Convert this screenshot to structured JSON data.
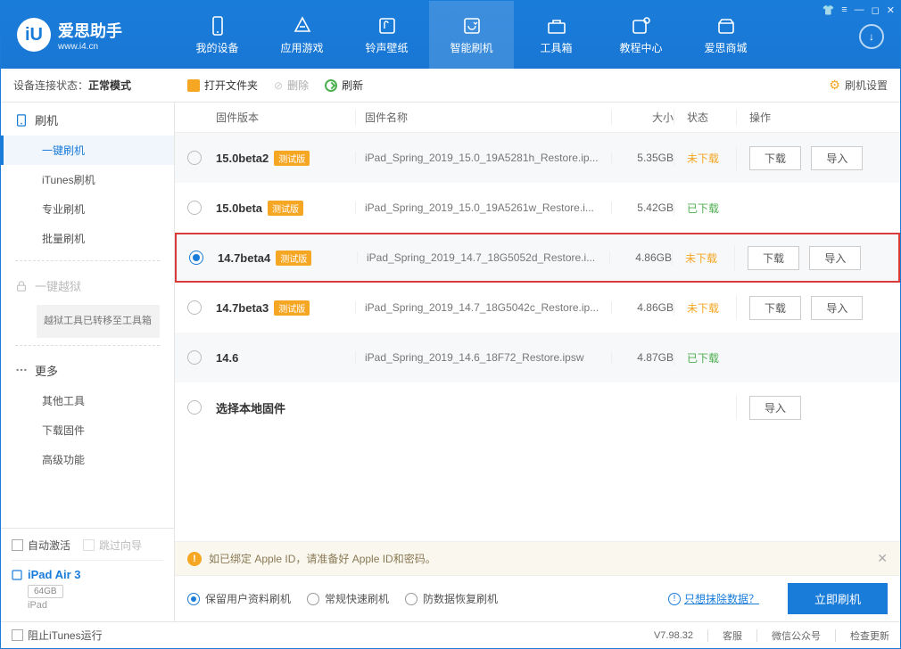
{
  "app": {
    "name": "爱思助手",
    "url": "www.i4.cn"
  },
  "nav": [
    {
      "label": "我的设备"
    },
    {
      "label": "应用游戏"
    },
    {
      "label": "铃声壁纸"
    },
    {
      "label": "智能刷机"
    },
    {
      "label": "工具箱"
    },
    {
      "label": "教程中心"
    },
    {
      "label": "爱思商城"
    }
  ],
  "conn": {
    "prefix": "设备连接状态：",
    "mode": "正常模式"
  },
  "toolbar": {
    "open": "打开文件夹",
    "delete": "删除",
    "refresh": "刷新",
    "settings": "刷机设置"
  },
  "sidebar": {
    "flash": {
      "title": "刷机",
      "items": [
        "一键刷机",
        "iTunes刷机",
        "专业刷机",
        "批量刷机"
      ]
    },
    "jailbreak": {
      "title": "一键越狱",
      "note": "越狱工具已转移至工具箱"
    },
    "more": {
      "title": "更多",
      "items": [
        "其他工具",
        "下载固件",
        "高级功能"
      ]
    },
    "auto": "自动激活",
    "skip": "跳过向导",
    "device": {
      "name": "iPad Air 3",
      "cap": "64GB",
      "type": "iPad"
    }
  },
  "cols": {
    "ver": "固件版本",
    "name": "固件名称",
    "size": "大小",
    "stat": "状态",
    "act": "操作"
  },
  "badge": "测试版",
  "rows": [
    {
      "ver": "15.0beta2",
      "beta": true,
      "name": "iPad_Spring_2019_15.0_19A5281h_Restore.ip...",
      "size": "5.35GB",
      "stat": "未下载",
      "statCls": "orange",
      "dl": true,
      "imp": true,
      "sel": false
    },
    {
      "ver": "15.0beta",
      "beta": true,
      "name": "iPad_Spring_2019_15.0_19A5261w_Restore.i...",
      "size": "5.42GB",
      "stat": "已下载",
      "statCls": "green",
      "dl": false,
      "imp": false,
      "sel": false
    },
    {
      "ver": "14.7beta4",
      "beta": true,
      "name": "iPad_Spring_2019_14.7_18G5052d_Restore.i...",
      "size": "4.86GB",
      "stat": "未下载",
      "statCls": "orange",
      "dl": true,
      "imp": true,
      "sel": true
    },
    {
      "ver": "14.7beta3",
      "beta": true,
      "name": "iPad_Spring_2019_14.7_18G5042c_Restore.ip...",
      "size": "4.86GB",
      "stat": "未下载",
      "statCls": "orange",
      "dl": true,
      "imp": true,
      "sel": false
    },
    {
      "ver": "14.6",
      "beta": false,
      "name": "iPad_Spring_2019_14.6_18F72_Restore.ipsw",
      "size": "4.87GB",
      "stat": "已下载",
      "statCls": "green",
      "dl": false,
      "imp": false,
      "sel": false
    }
  ],
  "localRow": {
    "label": "选择本地固件"
  },
  "btns": {
    "download": "下载",
    "import": "导入"
  },
  "notice": "如已绑定 Apple ID，请准备好 Apple ID和密码。",
  "options": [
    "保留用户资料刷机",
    "常规快速刷机",
    "防数据恢复刷机"
  ],
  "erase": "只想抹除数据？",
  "go": "立即刷机",
  "status": {
    "block": "阻止iTunes运行",
    "ver": "V7.98.32",
    "svc": "客服",
    "wx": "微信公众号",
    "upd": "检查更新"
  }
}
